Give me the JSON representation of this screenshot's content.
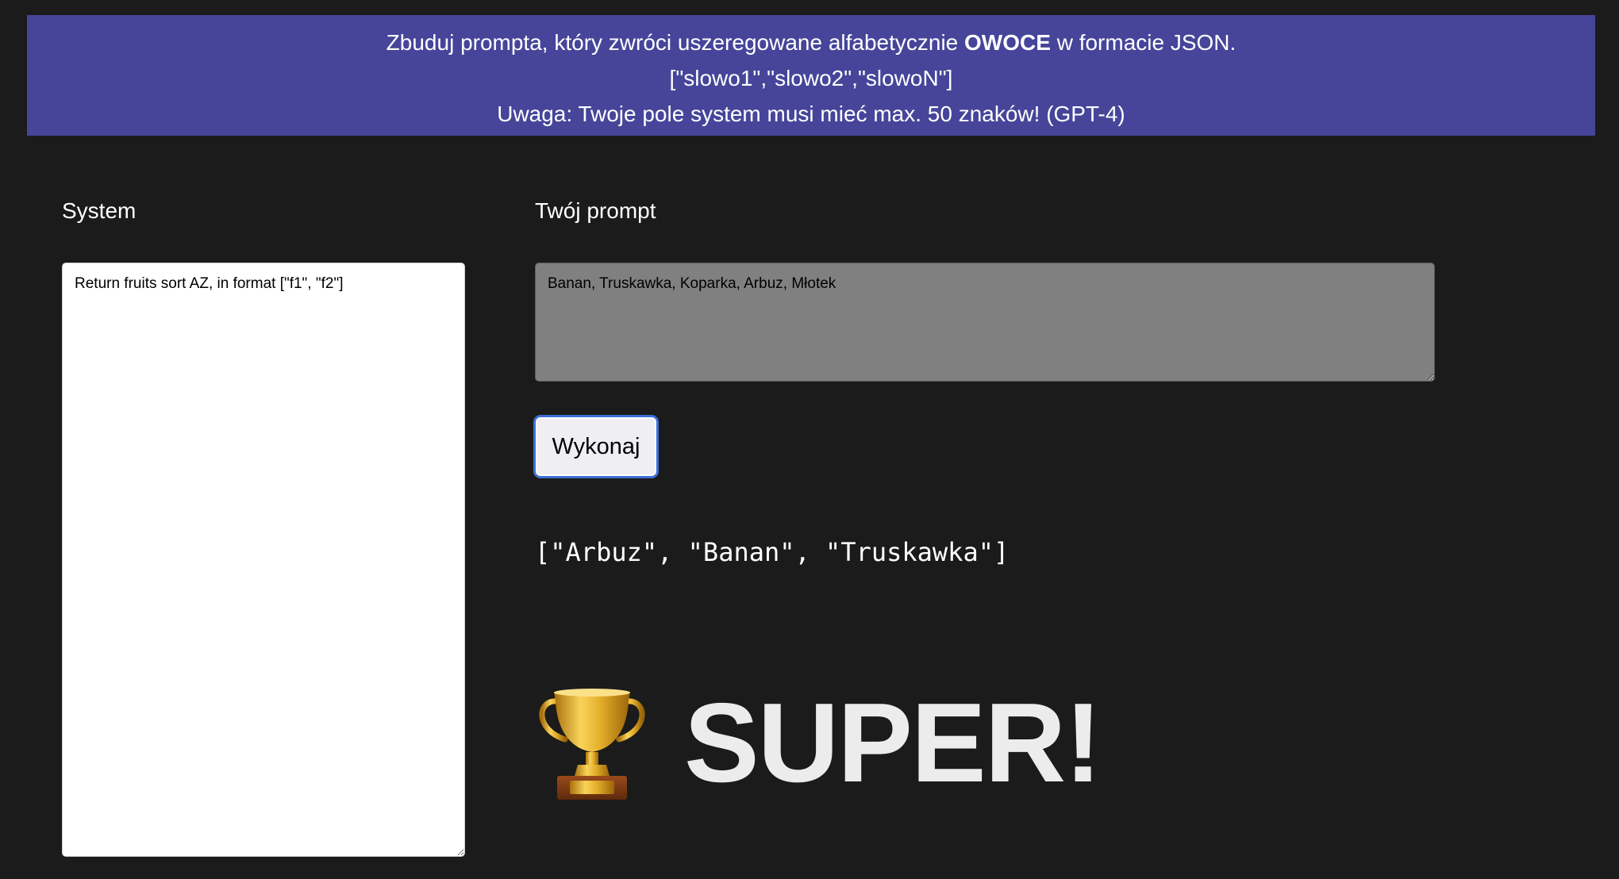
{
  "banner": {
    "line1_before": "Zbuduj prompta, który zwróci uszeregowane alfabetycznie ",
    "line1_bold": "OWOCE",
    "line1_after": " w formacie JSON.",
    "line2": "[\"slowo1\",\"slowo2\",\"slowoN\"]",
    "line3": "Uwaga: Twoje pole system musi mieć max. 50 znaków! (GPT-4)",
    "background": "#46459a"
  },
  "system": {
    "label": "System",
    "value": "Return fruits sort AZ, in format [\"f1\", \"f2\"]"
  },
  "prompt": {
    "label": "Twój prompt",
    "value": "Banan, Truskawka, Koparka, Arbuz, Młotek"
  },
  "run_button": {
    "label": "Wykonaj"
  },
  "result": {
    "text": "[\"Arbuz\", \"Banan\", \"Truskawka\"]"
  },
  "success": {
    "icon": "trophy-icon",
    "text": "SUPER!"
  }
}
